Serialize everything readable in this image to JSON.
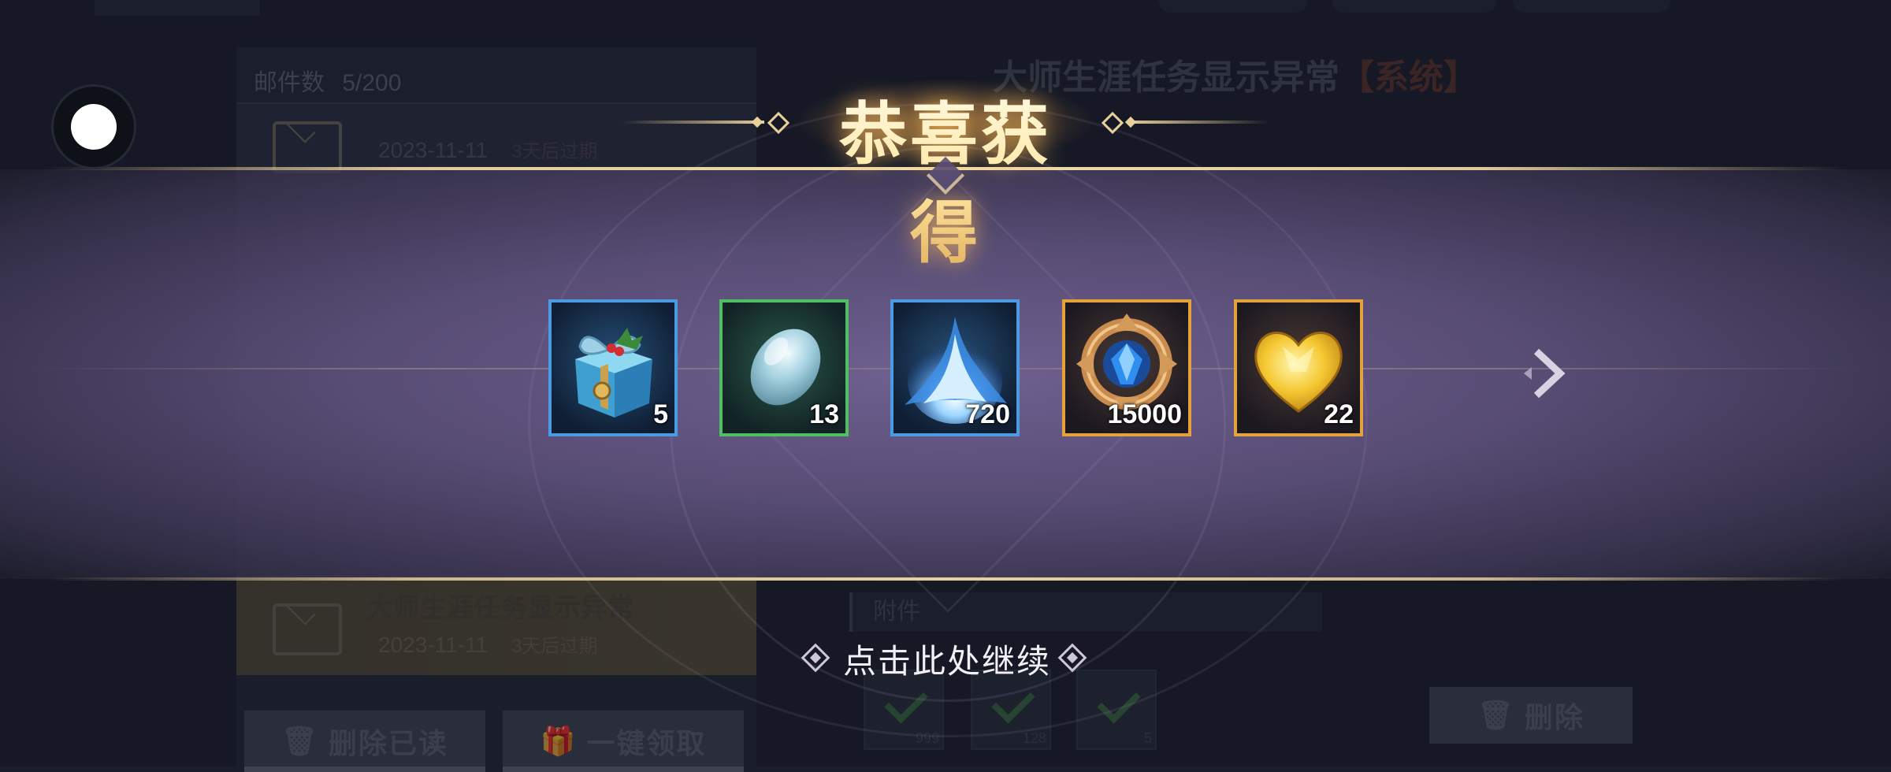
{
  "background": {
    "mail_count_label": "邮件数",
    "mail_count_value": "5/200",
    "mail_rows": [
      {
        "title": "",
        "date": "2023-11-11",
        "expiry": "3天后过期"
      },
      {
        "title": "大师生涯任务显示异常",
        "date": "2023-11-11",
        "expiry": "3天后过期"
      }
    ],
    "buttons": {
      "delete_read": "删除已读",
      "claim_all": "一键领取",
      "delete": "删除"
    },
    "detail_title": "大师生涯任务显示异常",
    "detail_tag": "【系统】",
    "attachment_label": "附件",
    "attachment_counts": [
      "999",
      "128",
      "5"
    ]
  },
  "popup": {
    "title": "恭喜获得",
    "rewards": [
      {
        "name": "gift-box",
        "quantity": "5",
        "rarity": "blue"
      },
      {
        "name": "crystal-stone",
        "quantity": "13",
        "rarity": "green"
      },
      {
        "name": "blue-flame",
        "quantity": "720",
        "rarity": "blue"
      },
      {
        "name": "sapphire-medallion",
        "quantity": "15000",
        "rarity": "gold"
      },
      {
        "name": "gold-heart-gem",
        "quantity": "22",
        "rarity": "gold"
      }
    ],
    "continue_text": "点击此处继续"
  },
  "icons": {
    "next": "chevron-right-icon",
    "floating": "floating-ball-icon"
  },
  "colors": {
    "rarity_blue": "#4b9be2",
    "rarity_green": "#4fc061",
    "rarity_gold": "#e6a23a",
    "title_gold": "#ffe6a0"
  }
}
